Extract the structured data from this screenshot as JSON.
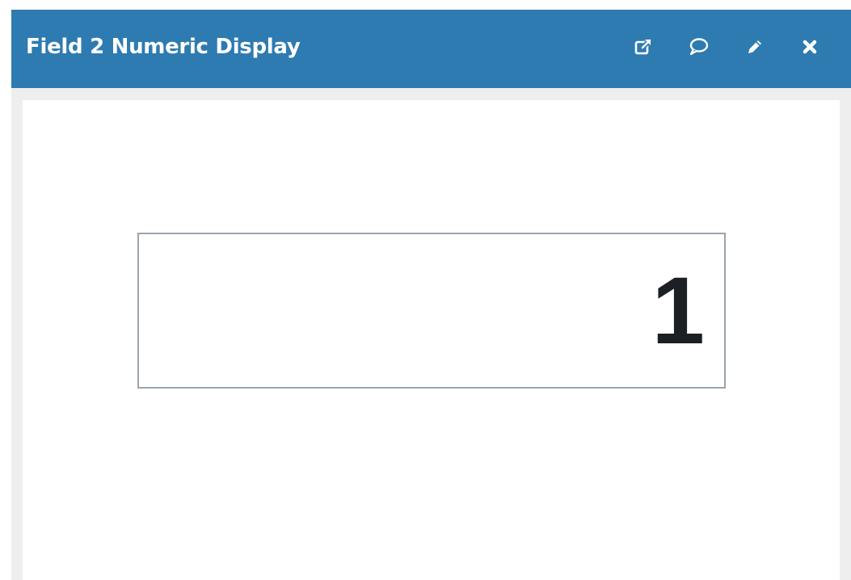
{
  "widget": {
    "title": "Field 2 Numeric Display",
    "header_color": "#2e7bb1",
    "actions": [
      {
        "icon": "external-link-icon"
      },
      {
        "icon": "comment-icon"
      },
      {
        "icon": "pencil-icon"
      },
      {
        "icon": "close-icon"
      }
    ]
  },
  "display": {
    "value": "1"
  }
}
